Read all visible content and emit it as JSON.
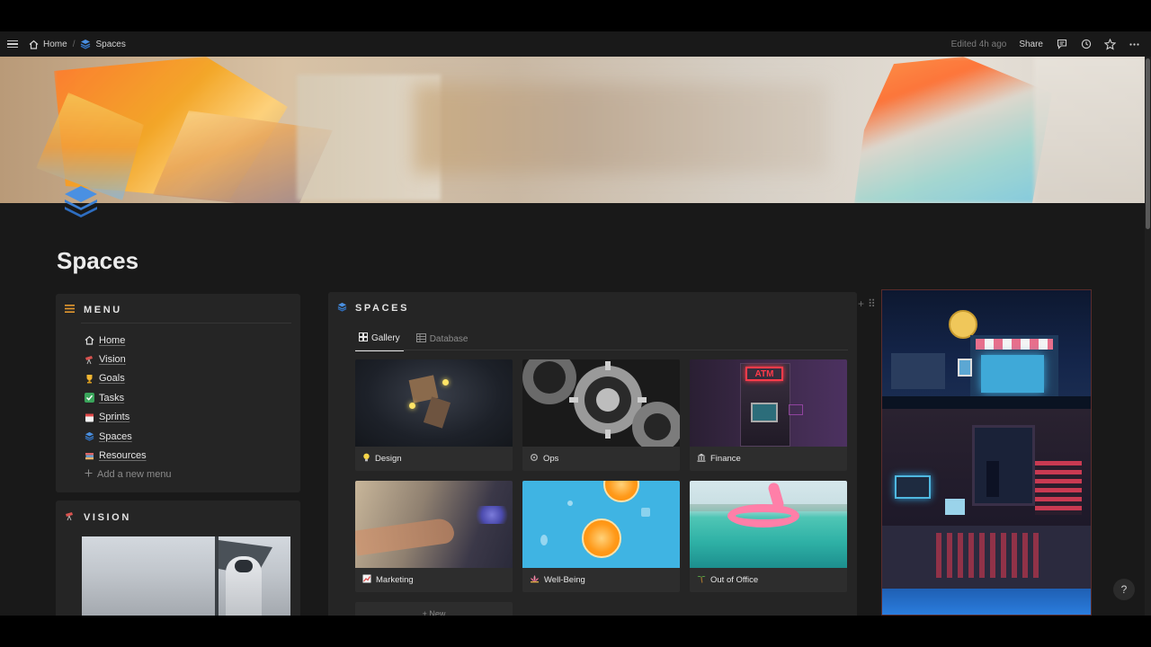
{
  "topbar": {
    "breadcrumbs": [
      {
        "label": "Home",
        "icon": "home-icon"
      },
      {
        "label": "Spaces",
        "icon": "stack-icon"
      }
    ],
    "separator": "/",
    "edited": "Edited 4h ago",
    "share_label": "Share"
  },
  "page": {
    "title": "Spaces"
  },
  "menu": {
    "heading": "MENU",
    "items": [
      {
        "label": "Home",
        "icon": "home-icon"
      },
      {
        "label": "Vision",
        "icon": "telescope-icon"
      },
      {
        "label": "Goals",
        "icon": "trophy-icon"
      },
      {
        "label": "Tasks",
        "icon": "check-icon"
      },
      {
        "label": "Sprints",
        "icon": "calendar-icon"
      },
      {
        "label": "Spaces",
        "icon": "stack-icon"
      },
      {
        "label": "Resources",
        "icon": "books-icon"
      }
    ],
    "add_label": "Add a new menu"
  },
  "vision": {
    "heading": "VISION"
  },
  "spaces": {
    "heading": "SPACES",
    "tabs": [
      {
        "label": "Gallery",
        "active": true
      },
      {
        "label": "Database",
        "active": false
      }
    ],
    "cards": [
      {
        "label": "Design",
        "icon": "lightbulb-icon"
      },
      {
        "label": "Ops",
        "icon": "gear-icon"
      },
      {
        "label": "Finance",
        "icon": "bank-icon"
      },
      {
        "label": "Marketing",
        "icon": "chart-icon"
      },
      {
        "label": "Well-Being",
        "icon": "lotus-icon"
      },
      {
        "label": "Out of Office",
        "icon": "palm-tree-icon"
      }
    ],
    "new_label": "+ New"
  },
  "help_label": "?",
  "colors": {
    "background": "#191919",
    "panel": "#252525",
    "card": "#2d2d2d",
    "accent_blue": "#3b82f6"
  }
}
